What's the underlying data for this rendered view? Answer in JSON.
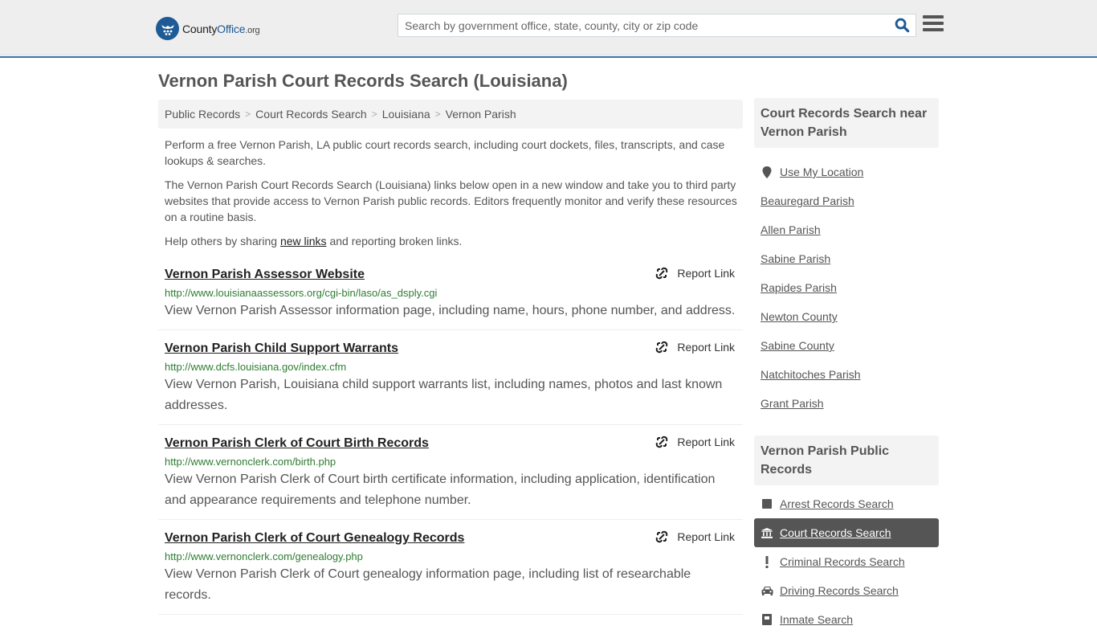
{
  "header": {
    "logo": {
      "part1": "County",
      "part2": "Office",
      "part3": ".org"
    },
    "search_placeholder": "Search by government office, state, county, city or zip code",
    "search_value": "",
    "brand_color": "#1e5a96",
    "accent_bar_color": "#3a78aa"
  },
  "page": {
    "title": "Vernon Parish Court Records Search (Louisiana)"
  },
  "breadcrumb": [
    {
      "label": "Public Records"
    },
    {
      "label": "Court Records Search"
    },
    {
      "label": "Louisiana"
    },
    {
      "label": "Vernon Parish"
    }
  ],
  "breadcrumb_separator": ">",
  "intro": {
    "p1": "Perform a free Vernon Parish, LA public court records search, including court dockets, files, transcripts, and case lookups & searches.",
    "p2": "The Vernon Parish Court Records Search (Louisiana) links below open in a new window and take you to third party websites that provide access to Vernon Parish public records. Editors frequently monitor and verify these resources on a routine basis.",
    "p3_before": "Help others by sharing ",
    "p3_link": "new links",
    "p3_after": " and reporting broken links."
  },
  "results": [
    {
      "title": "Vernon Parish Assessor Website",
      "url": "http://www.louisianaassessors.org/cgi-bin/laso/as_dsply.cgi",
      "description": "View Vernon Parish Assessor information page, including name, hours, phone number, and address.",
      "report_label": "Report Link"
    },
    {
      "title": "Vernon Parish Child Support Warrants",
      "url": "http://www.dcfs.louisiana.gov/index.cfm",
      "description": "View Vernon Parish, Louisiana child support warrants list, including names, photos and last known addresses.",
      "report_label": "Report Link"
    },
    {
      "title": "Vernon Parish Clerk of Court Birth Records",
      "url": "http://www.vernonclerk.com/birth.php",
      "description": "View Vernon Parish Clerk of Court birth certificate information, including application, identification and appearance requirements and telephone number.",
      "report_label": "Report Link"
    },
    {
      "title": "Vernon Parish Clerk of Court Genealogy Records",
      "url": "http://www.vernonclerk.com/genealogy.php",
      "description": "View Vernon Parish Clerk of Court genealogy information page, including list of researchable records.",
      "report_label": "Report Link"
    }
  ],
  "sidebar": {
    "nearby": {
      "heading": "Court Records Search near Vernon Parish",
      "use_location": "Use My Location",
      "items": [
        "Beauregard Parish",
        "Allen Parish",
        "Sabine Parish",
        "Rapides Parish",
        "Newton County",
        "Sabine County",
        "Natchitoches Parish",
        "Grant Parish"
      ]
    },
    "public_records": {
      "heading": "Vernon Parish Public Records",
      "items": [
        {
          "label": "Arrest Records Search",
          "icon": "square-icon",
          "active": false
        },
        {
          "label": "Court Records Search",
          "icon": "courthouse-icon",
          "active": true
        },
        {
          "label": "Criminal Records Search",
          "icon": "exclamation-icon",
          "active": false
        },
        {
          "label": "Driving Records Search",
          "icon": "car-icon",
          "active": false
        },
        {
          "label": "Inmate Search",
          "icon": "inmate-icon",
          "active": false
        }
      ]
    }
  }
}
